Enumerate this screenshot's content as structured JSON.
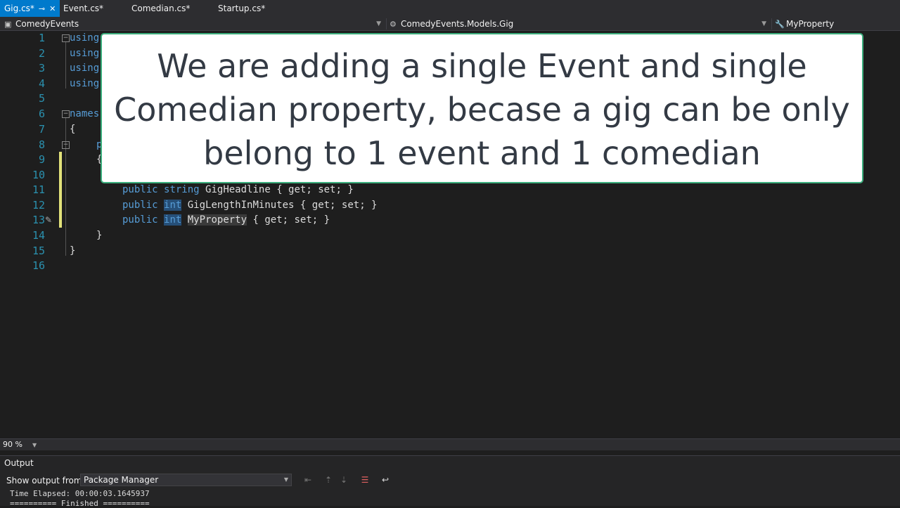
{
  "tabs": [
    {
      "label": "Gig.cs*",
      "active": true
    },
    {
      "label": "Event.cs*",
      "active": false
    },
    {
      "label": "Comedian.cs*",
      "active": false
    },
    {
      "label": "Startup.cs*",
      "active": false
    }
  ],
  "navbar": {
    "project": "ComedyEvents",
    "type": "ComedyEvents.Models.Gig",
    "member": "MyProperty"
  },
  "editor": {
    "line_numbers": [
      "1",
      "2",
      "3",
      "4",
      "5",
      "6",
      "7",
      "8",
      "9",
      "10",
      "11",
      "12",
      "13",
      "14",
      "15",
      "16"
    ],
    "lines": {
      "l1": "using",
      "l2": "using",
      "l3": "using",
      "l4": "using",
      "l6": "names",
      "l7": "{",
      "l8": "p",
      "l9": "{",
      "l11_kw": "public",
      "l11_type": "string",
      "l11_name": "GigHeadline",
      "l11_rest": "{ get; set; }",
      "l12_kw": "public",
      "l12_type": "int",
      "l12_name": "GigLengthInMinutes",
      "l12_rest": "{ get; set; }",
      "l13_kw": "public",
      "l13_type": "int",
      "l13_name": "MyProperty",
      "l13_rest": "{ get; set; }",
      "l14": "}",
      "l15": "}"
    },
    "overlay_text": "We are adding a single Event and single Comedian property, becase a gig can be only belong to 1 event and 1 comedian"
  },
  "zoom": "90 %",
  "output": {
    "title": "Output",
    "show_from_label": "Show output from:",
    "source": "Package Manager",
    "lines": [
      "Time Elapsed: 00:00:03.1645937",
      "========== Finished =========="
    ]
  },
  "colors": {
    "accent": "#007acc",
    "keyword": "#569cd6",
    "linenumber": "#2b91af",
    "overlay_border": "#3cae7d"
  }
}
